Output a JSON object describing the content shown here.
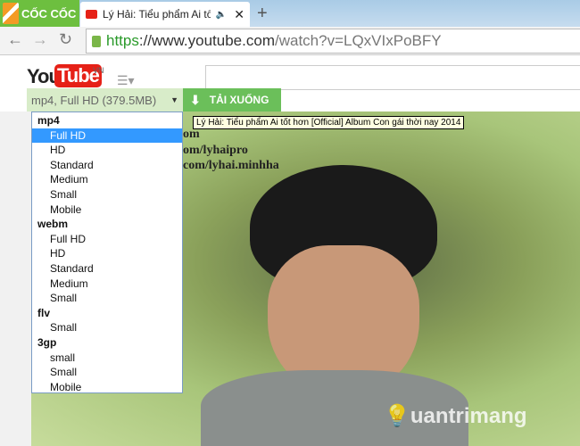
{
  "browser": {
    "brand": "CỐC CỐC",
    "tab_title": "Lý Hải: Tiểu phẩm Ai tốt hơn [Official] Album Con gái thời nay 2014",
    "url_scheme": "https",
    "url_host": "://www.youtube.com",
    "url_path": "/watch?v=LQxVIxPoBFY"
  },
  "youtube": {
    "logo_you": "You",
    "logo_tube": "Tube",
    "region": "VN"
  },
  "downloader": {
    "selected": "mp4, Full HD (379.5MB)",
    "download_label": "TẢI XUỐNG",
    "groups": [
      {
        "name": "mp4",
        "options": [
          "Full HD",
          "HD",
          "Standard",
          "Medium",
          "Small",
          "Mobile"
        ]
      },
      {
        "name": "webm",
        "options": [
          "Full HD",
          "HD",
          "Standard",
          "Medium",
          "Small"
        ]
      },
      {
        "name": "flv",
        "options": [
          "Small"
        ]
      },
      {
        "name": "3gp",
        "options": [
          "small",
          "Small",
          "Mobile"
        ]
      }
    ]
  },
  "tooltip": "Lý Hải: Tiểu phẩm Ai tốt hơn [Official] Album Con gái thời nay 2014",
  "video": {
    "overlay_lines": [
      "om",
      "om/lyhaipro",
      "com/lyhai.minhha"
    ],
    "watermark": "uantrimang"
  }
}
